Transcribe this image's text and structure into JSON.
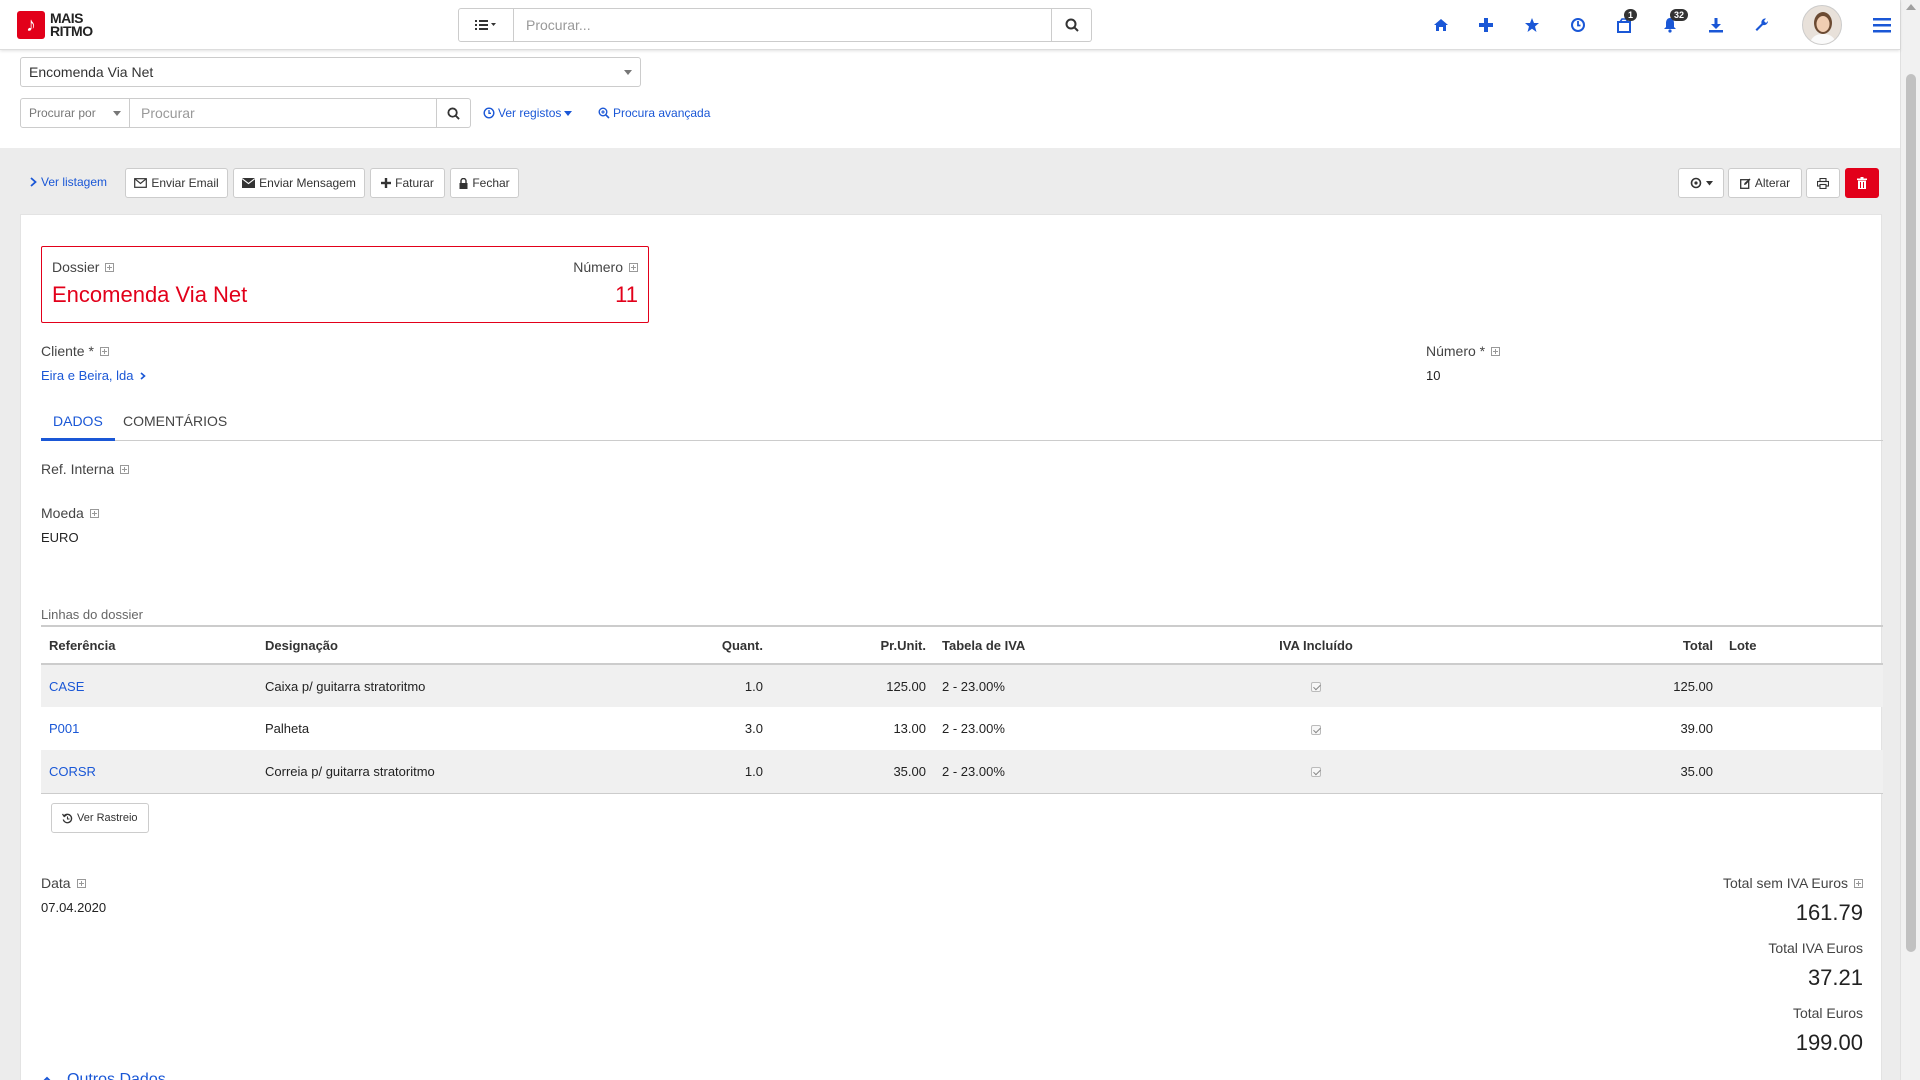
{
  "header": {
    "logo_line1": "MAIS",
    "logo_line2": "RITMO",
    "search_placeholder": "Procurar...",
    "notif_badge_box": "1",
    "notif_badge_bell": "32"
  },
  "filter": {
    "dossier_selected": "Encomenda Via Net",
    "procurar_por": "Procurar por",
    "procurar_placeholder": "Procurar",
    "ver_registos": "Ver registos",
    "procura_avancada": "Procura avançada"
  },
  "toolbar": {
    "ver_listagem": "Ver listagem",
    "enviar_email": "Enviar Email",
    "enviar_mensagem": "Enviar Mensagem",
    "faturar": "Faturar",
    "fechar": "Fechar",
    "alterar": "Alterar"
  },
  "record": {
    "dossier_label": "Dossier",
    "dossier_value": "Encomenda Via Net",
    "numero_label": "Número",
    "numero_value": "11",
    "cliente_label": "Cliente *",
    "cliente_value": "Eira e Beira, lda",
    "numero2_label": "Número *",
    "numero2_value": "10"
  },
  "tabs": [
    "DADOS",
    "COMENTÁRIOS"
  ],
  "dados": {
    "ref_interna_label": "Ref. Interna",
    "moeda_label": "Moeda",
    "moeda_value": "EURO",
    "linhas_title": "Linhas do dossier"
  },
  "table": {
    "headers": [
      "Referência",
      "Designação",
      "Quant.",
      "Pr.Unit.",
      "Tabela de IVA",
      "IVA Incluído",
      "Total",
      "Lote"
    ],
    "rows": [
      {
        "ref": "CASE",
        "designacao": "Caixa p/ guitarra stratoritmo",
        "quant": "1.0",
        "preco": "125.00",
        "iva": "2 - 23.00%",
        "incluido": true,
        "total": "125.00",
        "lote": ""
      },
      {
        "ref": "P001",
        "designacao": "Palheta",
        "quant": "3.0",
        "preco": "13.00",
        "iva": "2 - 23.00%",
        "incluido": true,
        "total": "39.00",
        "lote": ""
      },
      {
        "ref": "CORSR",
        "designacao": "Correia p/ guitarra stratoritmo",
        "quant": "1.0",
        "preco": "35.00",
        "iva": "2 - 23.00%",
        "incluido": true,
        "total": "35.00",
        "lote": ""
      }
    ]
  },
  "ver_rastreio": "Ver Rastreio",
  "data_label": "Data",
  "data_value": "07.04.2020",
  "totals": {
    "sem_iva_label": "Total sem IVA Euros",
    "sem_iva_value": "161.79",
    "iva_label": "Total IVA Euros",
    "iva_value": "37.21",
    "total_label": "Total Euros",
    "total_value": "199.00"
  },
  "outros_dados": "Outros Dados",
  "colors": {
    "accent": "#1a57d6",
    "brand_red": "#e2001a"
  }
}
